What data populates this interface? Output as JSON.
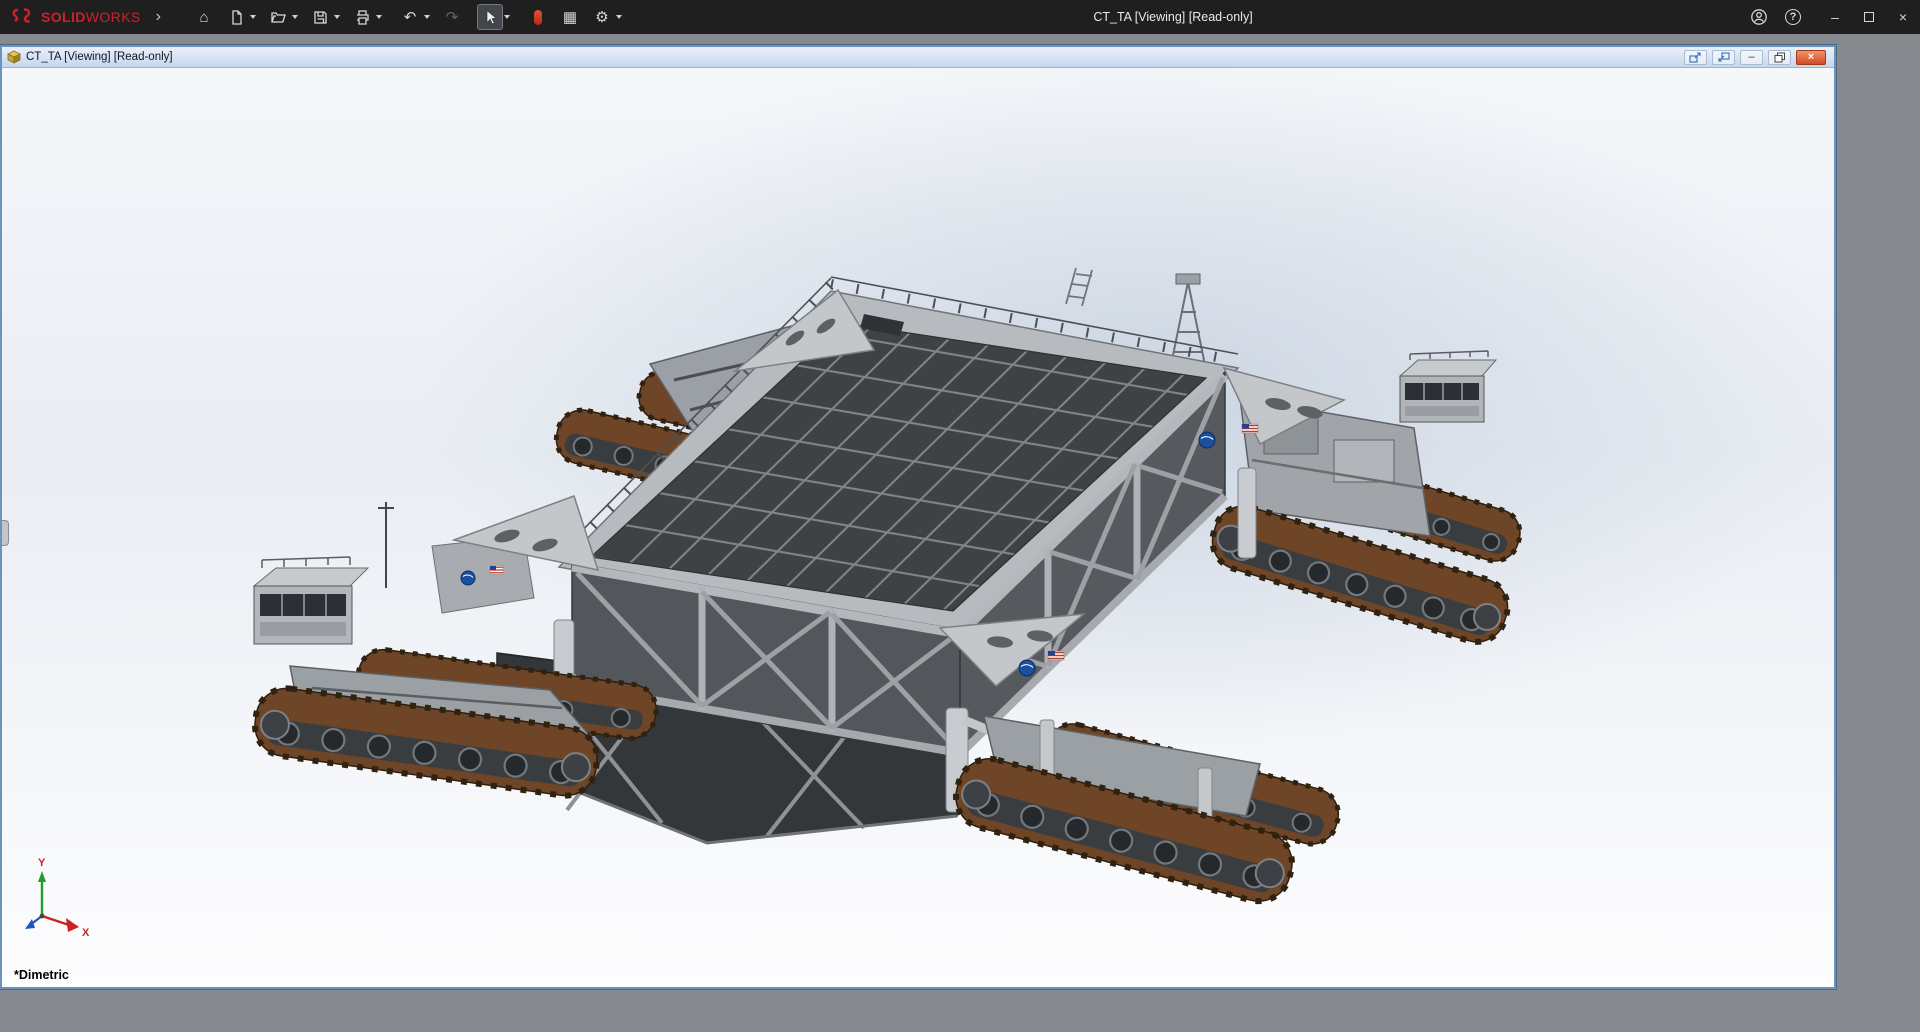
{
  "app_titlebar": {
    "brand_bold": "SOLID",
    "brand_light": "WORKS",
    "center_title": "CT_TA [Viewing] [Read-only]",
    "window_controls": {
      "minimize_glyph": "–",
      "close_glyph": "×"
    }
  },
  "icons": {
    "home": "⌂",
    "undo": "↶",
    "redo": "↷",
    "table": "▦",
    "gear": "⚙",
    "help": "?",
    "chevron": "›"
  },
  "document_window": {
    "title": "CT_TA [Viewing] [Read-only]",
    "controls": {
      "minimize_glyph": "–",
      "close_glyph": "×"
    }
  },
  "viewport": {
    "orientation_label": "*Dimetric",
    "triad": {
      "x": "X",
      "y": "Y"
    },
    "decals": [
      "nasa-meatball-logo",
      "us-flag"
    ]
  },
  "colors": {
    "brand_red": "#d1202a",
    "titlebar_bg": "#1f1f1f",
    "doc_close_button": "#d9542b",
    "mdi_background": "#868a8e"
  }
}
